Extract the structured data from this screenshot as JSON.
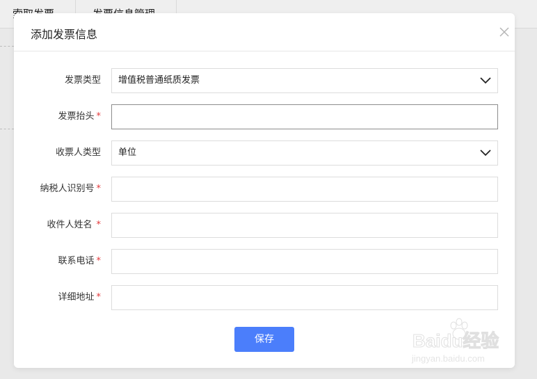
{
  "background": {
    "tabs": [
      "索取发票",
      "发票信息管理"
    ]
  },
  "modal": {
    "title": "添加发票信息",
    "close_icon": "close-icon",
    "fields": [
      {
        "label": "发票类型",
        "required": false,
        "type": "select",
        "value": "增值税普通纸质发票"
      },
      {
        "label": "发票抬头",
        "required": true,
        "type": "input",
        "value": ""
      },
      {
        "label": "收票人类型",
        "required": false,
        "type": "select",
        "value": "单位"
      },
      {
        "label": "纳税人识别号",
        "required": true,
        "type": "input",
        "value": ""
      },
      {
        "label": "收件人姓名",
        "required": true,
        "type": "input",
        "value": ""
      },
      {
        "label": "联系电话",
        "required": true,
        "type": "input",
        "value": ""
      },
      {
        "label": "详细地址",
        "required": true,
        "type": "input",
        "value": ""
      }
    ],
    "required_mark": "*",
    "save_label": "保存"
  },
  "watermark": {
    "brand": "Baidu经验",
    "url": "jingyan.baidu.com"
  },
  "colors": {
    "accent": "#4b7efb",
    "required": "#e4393c",
    "border": "#dcdcdc"
  }
}
